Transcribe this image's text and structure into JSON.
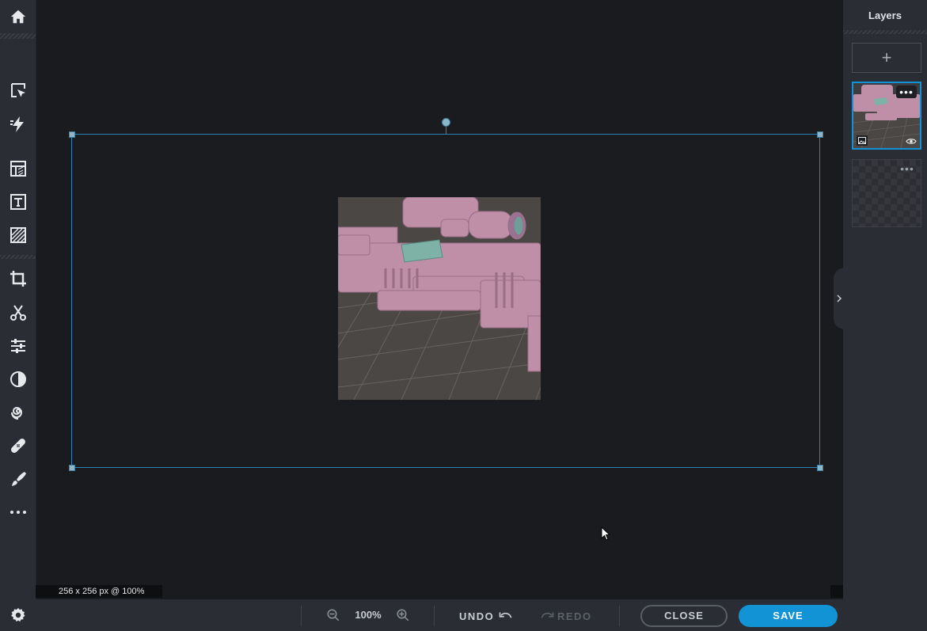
{
  "toolbar": {
    "tools": [
      {
        "name": "home",
        "icon": "home-icon"
      },
      {
        "name": "arrange",
        "icon": "select-arrow-icon"
      },
      {
        "name": "quick-edit",
        "icon": "lightning-icon"
      },
      {
        "name": "templates",
        "icon": "layout-icon"
      },
      {
        "name": "text",
        "icon": "text-icon"
      },
      {
        "name": "texture",
        "icon": "stripes-icon"
      },
      {
        "name": "crop",
        "icon": "crop-icon"
      },
      {
        "name": "cutout",
        "icon": "scissors-icon"
      },
      {
        "name": "adjust",
        "icon": "sliders-icon"
      },
      {
        "name": "effects",
        "icon": "contrast-icon"
      },
      {
        "name": "liquify",
        "icon": "spiral-icon"
      },
      {
        "name": "retouch",
        "icon": "bandage-icon"
      },
      {
        "name": "draw",
        "icon": "brush-icon"
      },
      {
        "name": "more",
        "icon": "more-dots-icon"
      }
    ],
    "settings_icon": "gear-icon"
  },
  "canvas": {
    "info_label": "256 x 256 px @ 100%",
    "selection_color": "#2b86b6"
  },
  "bottombar": {
    "zoom_value": "100%",
    "undo_label": "UNDO",
    "redo_label": "REDO",
    "close_label": "CLOSE",
    "save_label": "SAVE",
    "save_color": "#1293d5"
  },
  "layers": {
    "title": "Layers",
    "add_label": "+",
    "items": [
      {
        "name": "image-layer",
        "selected": true,
        "menu": "•••"
      },
      {
        "name": "background-layer",
        "selected": false,
        "menu": "•••"
      }
    ]
  }
}
